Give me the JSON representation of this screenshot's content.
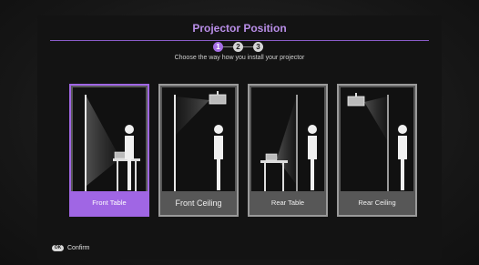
{
  "header": {
    "title": "Projector Position"
  },
  "steps": [
    "1",
    "2",
    "3"
  ],
  "subtitle": "Choose the way how you install your projector",
  "options": [
    {
      "label": "Front Table",
      "selected": true
    },
    {
      "label": "Front Ceiling",
      "selected": false
    },
    {
      "label": "Rear Table",
      "selected": false
    },
    {
      "label": "Rear Ceiling",
      "selected": false
    }
  ],
  "footer": {
    "ok_badge": "OK",
    "confirm_label": "Confirm"
  },
  "colors": {
    "accent": "#a066e4",
    "title": "#b98ee8",
    "card_bg": "#575757"
  }
}
